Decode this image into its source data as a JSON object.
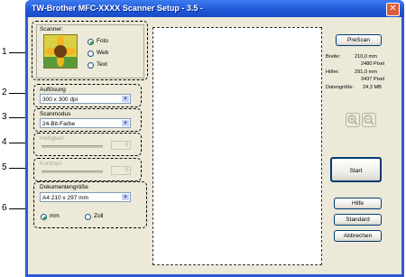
{
  "window": {
    "title": "TW-Brother MFC-XXXX  Scanner Setup - 3.5 -",
    "close_symbol": "✕"
  },
  "callouts": [
    "1",
    "2",
    "3",
    "4",
    "5",
    "6"
  ],
  "scanner": {
    "label": "Scanner:",
    "options": [
      "Foto",
      "Web",
      "Text"
    ],
    "selected": "Foto"
  },
  "resolution": {
    "label": "Auflösung",
    "value": "300 x 300 dpi"
  },
  "scanmode": {
    "label": "Scanmodus",
    "value": "24-Bit-Farbe"
  },
  "brightness": {
    "label": "Helligkeit",
    "value": "0"
  },
  "contrast": {
    "label": "Kontrast",
    "value": "0"
  },
  "docsize": {
    "label": "Dokumentengröße",
    "value": "A4 210 x 297 mm",
    "units": [
      "mm",
      "Zoll"
    ],
    "selected_unit": "mm"
  },
  "info": {
    "width_label": "Breite:",
    "width_mm": "210,0 mm",
    "width_px": "2480 Pixel",
    "height_label": "Höhe:",
    "height_mm": "291,0 mm",
    "height_px": "3437 Pixel",
    "size_label": "Datengröße:",
    "size_value": "24,3 MB"
  },
  "buttons": {
    "prescan": "PreScan",
    "start": "Start",
    "help": "Hilfe",
    "default": "Standard",
    "cancel": "Abbrechen"
  }
}
